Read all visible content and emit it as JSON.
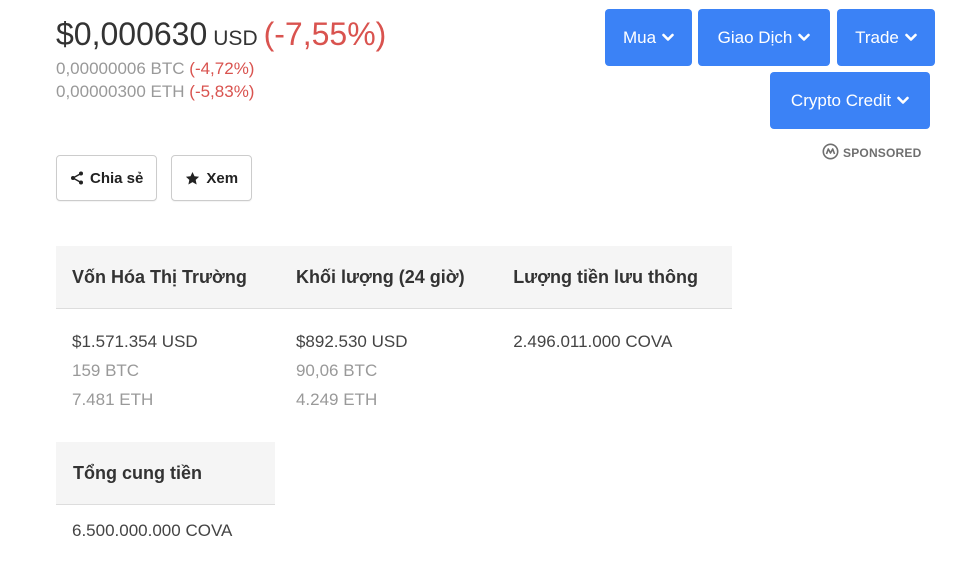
{
  "price": {
    "value": "$0,000630",
    "currency": "USD",
    "change": "(-7,55%)"
  },
  "sub_prices": [
    {
      "value": "0,00000006 BTC",
      "change": "(-4,72%)"
    },
    {
      "value": "0,00000300 ETH",
      "change": "(-5,83%)"
    }
  ],
  "actions": {
    "share_label": "Chia sẻ",
    "watch_label": "Xem"
  },
  "trade_buttons": {
    "buy": "Mua",
    "exchange": "Giao Dịch",
    "trade": "Trade",
    "credit": "Crypto Credit"
  },
  "sponsored": "SPONSORED",
  "stats": {
    "headers": [
      "Vốn Hóa Thị Trường",
      "Khối lượng (24 giờ)",
      "Lượng tiền lưu thông"
    ],
    "market_cap": [
      "$1.571.354 USD",
      "159 BTC",
      "7.481 ETH"
    ],
    "volume": [
      "$892.530 USD",
      "90,06 BTC",
      "4.249 ETH"
    ],
    "circulating": [
      "2.496.011.000 COVA"
    ]
  },
  "supply": {
    "header": "Tổng cung tiền",
    "value": "6.500.000.000 COVA"
  },
  "colors": {
    "accent_blue": "#3b82f6",
    "negative_red": "#d9534f",
    "muted_gray": "#999999"
  }
}
